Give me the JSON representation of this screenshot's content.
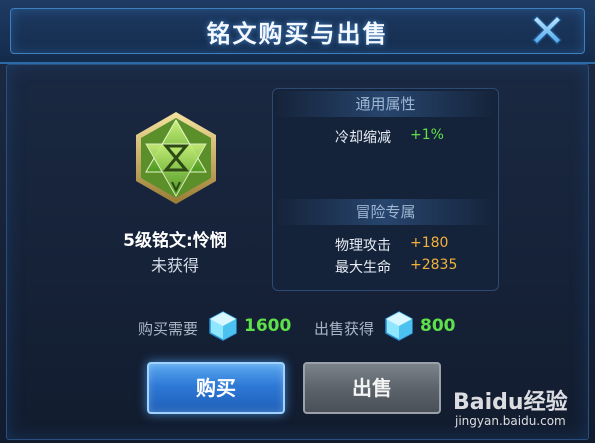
{
  "dialog": {
    "title": "铭文购买与出售"
  },
  "rune": {
    "name": "5级铭文:怜悯",
    "status": "未获得",
    "icon": "rune-hexagram-icon",
    "rune_color": "#7fc23a"
  },
  "attributes": {
    "general_header": "通用属性",
    "general_stats": [
      {
        "label": "冷却缩减",
        "value": "+1%"
      }
    ],
    "adventure_header": "冒险专属",
    "adventure_stats": [
      {
        "label": "物理攻击",
        "value": "+180"
      },
      {
        "label": "最大生命",
        "value": "+2835"
      }
    ]
  },
  "prices": {
    "buy_label": "购买需要",
    "buy_value": "1600",
    "sell_label": "出售获得",
    "sell_value": "800",
    "currency_icon": "diamond-icon"
  },
  "buttons": {
    "buy": "购买",
    "sell": "出售"
  },
  "watermark": {
    "logo": "Baidu经验",
    "url": "jingyan.baidu.com"
  },
  "colors": {
    "positive_green": "#5ee04a",
    "bonus_orange": "#f2b13a",
    "accent_blue": "#2e79d6"
  }
}
